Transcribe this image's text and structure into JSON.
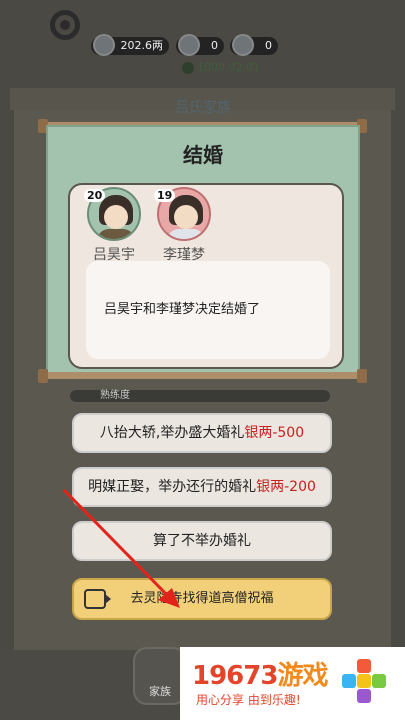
{
  "header": {
    "silver": "202.6两",
    "res_a": "0",
    "res_b": "0",
    "clock": "1000.02.01",
    "family_title": "吕氏家族"
  },
  "modal": {
    "title": "结婚",
    "people": [
      {
        "name": "吕昊宇",
        "age": "20"
      },
      {
        "name": "李瑾梦",
        "age": "19"
      }
    ],
    "message": "吕昊宇和李瑾梦决定结婚了"
  },
  "progress_label": "熟练度",
  "options": [
    {
      "label": "八抬大轿,举办盛大婚礼",
      "cost": "银两-500"
    },
    {
      "label": "明媒正娶，举办还行的婚礼",
      "cost": "银两-200"
    },
    {
      "label": "算了不举办婚礼",
      "cost": ""
    }
  ],
  "blessing_button": "去灵隐寺找得道高僧祝福",
  "home_label": "家族",
  "watermark": {
    "brand": "19673",
    "suffix": "游戏",
    "slogan": "用心分享  由到乐趣!"
  },
  "colors": {
    "modal_bg": "#a4c3ae",
    "cost": "#c82020",
    "blessing": "#f2d07a",
    "watermark": "#e3442a"
  }
}
